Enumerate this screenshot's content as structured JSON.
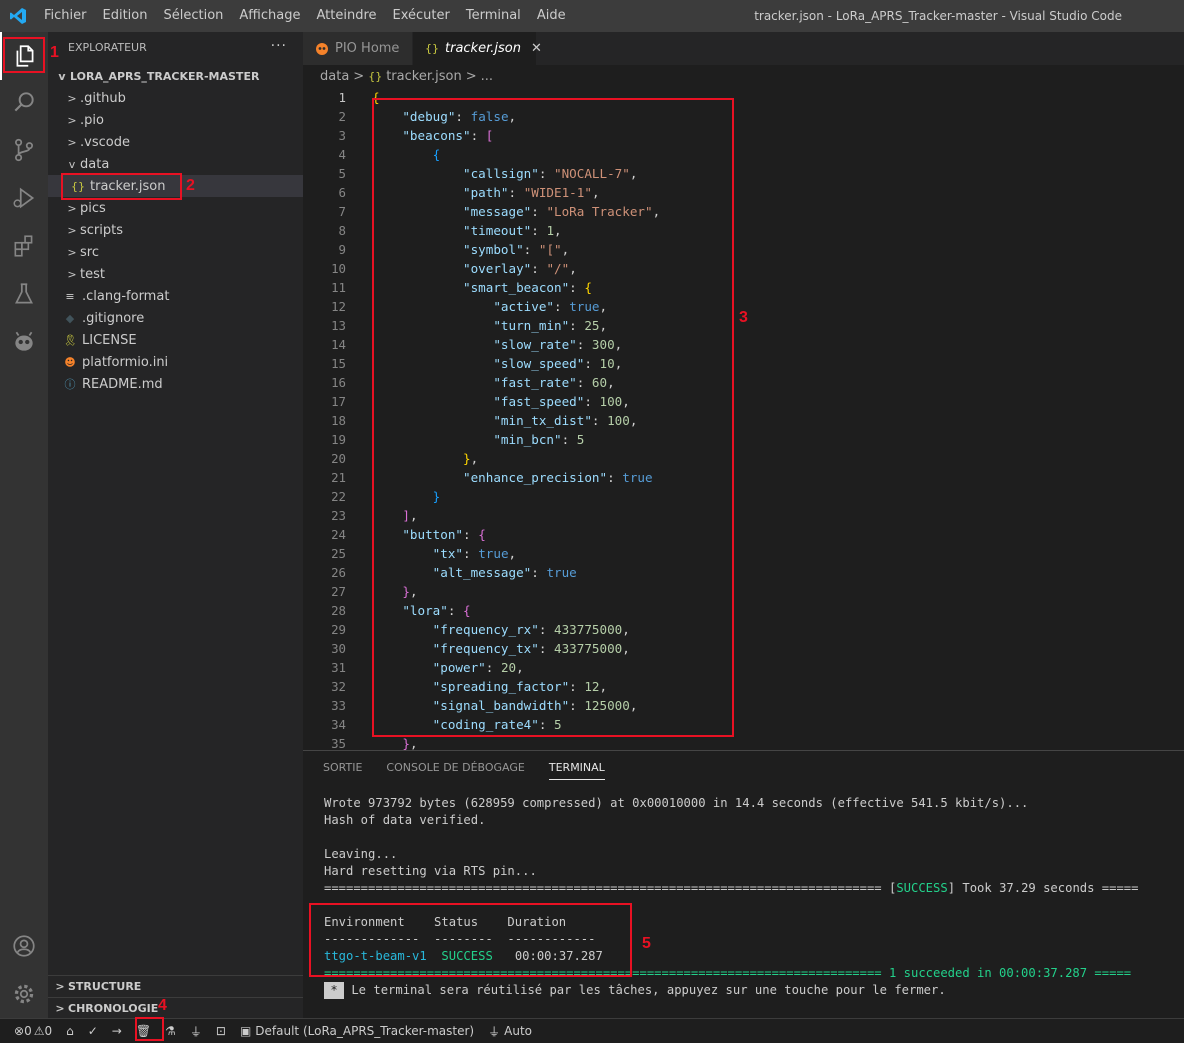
{
  "titlebar": {
    "menu": [
      "Fichier",
      "Edition",
      "Sélection",
      "Affichage",
      "Atteindre",
      "Exécuter",
      "Terminal",
      "Aide"
    ],
    "window_title": "tracker.json - LoRa_APRS_Tracker-master - Visual Studio Code"
  },
  "sidebar": {
    "header": "EXPLORATEUR",
    "more": "···",
    "project": "LORA_APRS_TRACKER-MASTER",
    "items": [
      {
        "label": ".github",
        "type": "folder",
        "chevron": ">"
      },
      {
        "label": ".pio",
        "type": "folder",
        "chevron": ">"
      },
      {
        "label": ".vscode",
        "type": "folder",
        "chevron": ">"
      },
      {
        "label": "data",
        "type": "folder-open",
        "chevron": "v"
      },
      {
        "label": "tracker.json",
        "type": "json",
        "icon": "{}"
      },
      {
        "label": "pics",
        "type": "folder",
        "chevron": ">"
      },
      {
        "label": "scripts",
        "type": "folder",
        "chevron": ">"
      },
      {
        "label": "src",
        "type": "folder",
        "chevron": ">"
      },
      {
        "label": "test",
        "type": "folder",
        "chevron": ">"
      },
      {
        "label": ".clang-format",
        "type": "file",
        "icon": "≡"
      },
      {
        "label": ".gitignore",
        "type": "file",
        "icon": "◆"
      },
      {
        "label": "LICENSE",
        "type": "file",
        "icon": "🎗"
      },
      {
        "label": "platformio.ini",
        "type": "file",
        "icon": "☻"
      },
      {
        "label": "README.md",
        "type": "file",
        "icon": "ⓘ"
      }
    ],
    "structure": "STRUCTURE",
    "chronologie": "CHRONOLOGIE"
  },
  "tabs": [
    {
      "label": "PIO Home",
      "icon": "pio-icon"
    },
    {
      "label": "tracker.json",
      "icon": "{}",
      "close": "✕"
    }
  ],
  "breadcrumb": {
    "folder": "data",
    "sep": ">",
    "file_icon": "{}",
    "file": "tracker.json",
    "more": "..."
  },
  "editor": {
    "lines": [
      "{",
      "    \"debug\": false,",
      "    \"beacons\": [",
      "        {",
      "            \"callsign\": \"NOCALL-7\",",
      "            \"path\": \"WIDE1-1\",",
      "            \"message\": \"LoRa Tracker\",",
      "            \"timeout\": 1,",
      "            \"symbol\": \"[\",",
      "            \"overlay\": \"/\",",
      "            \"smart_beacon\": {",
      "                \"active\": true,",
      "                \"turn_min\": 25,",
      "                \"slow_rate\": 300,",
      "                \"slow_speed\": 10,",
      "                \"fast_rate\": 60,",
      "                \"fast_speed\": 100,",
      "                \"min_tx_dist\": 100,",
      "                \"min_bcn\": 5",
      "            },",
      "            \"enhance_precision\": true",
      "        }",
      "    ],",
      "    \"button\": {",
      "        \"tx\": true,",
      "        \"alt_message\": true",
      "    },",
      "    \"lora\": {",
      "        \"frequency_rx\": 433775000,",
      "        \"frequency_tx\": 433775000,",
      "        \"power\": 20,",
      "        \"spreading_factor\": 12,",
      "        \"signal_bandwidth\": 125000,",
      "        \"coding_rate4\": 5",
      "    },"
    ]
  },
  "panel": {
    "tabs": [
      "SORTIE",
      "CONSOLE DE DÉBOGAGE",
      "TERMINAL"
    ],
    "terminal": {
      "wrote": "Wrote 973792 bytes (628959 compressed) at 0x00010000 in 14.4 seconds (effective 541.5 kbit/s)...",
      "hash": "Hash of data verified.",
      "leaving": "Leaving...",
      "reset": "Hard resetting via RTS pin...",
      "success_sep_left": "============================================================================ [",
      "success_word": "SUCCESS",
      "success_sep_right": "] Took 37.29 seconds =====",
      "table_header": "Environment    Status    Duration",
      "table_dashes": "-------------  --------  ------------",
      "env": "ttgo-t-beam-v1",
      "status": "SUCCESS",
      "duration": "00:00:37.287",
      "summary": "============================================================================ 1 succeeded in 00:00:37.287 =====",
      "reuse_star": "*",
      "reuse": "Le terminal sera réutilisé par les tâches, appuyez sur une touche pour le fermer."
    }
  },
  "statusbar": {
    "errors": "0",
    "warnings": "0",
    "env": "Default (LoRa_APRS_Tracker-master)",
    "auto": "Auto"
  },
  "annotations": [
    "1",
    "2",
    "3",
    "4",
    "5"
  ]
}
